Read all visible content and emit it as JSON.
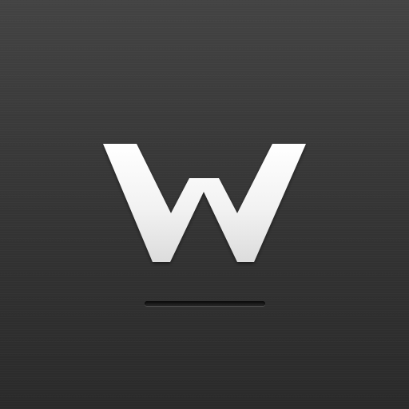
{
  "icon": {
    "logo_name": "w-logo-icon",
    "letter": "W",
    "colors": {
      "background_top": "#434343",
      "background_bottom": "#2a2a2a",
      "letter_light": "#ffffff",
      "letter_shade": "#dcdcdc",
      "bar": "#141414"
    }
  }
}
